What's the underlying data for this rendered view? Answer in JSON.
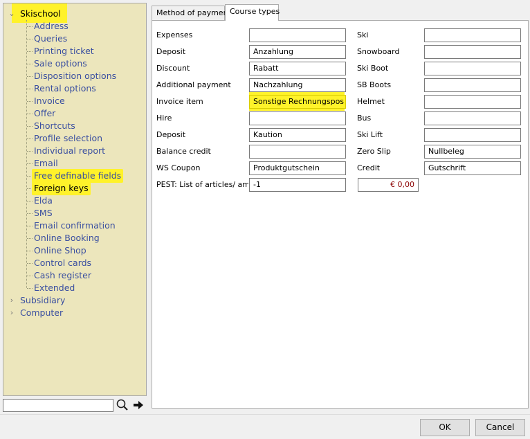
{
  "tree": {
    "root": "Skischool",
    "children": [
      "Address",
      "Queries",
      "Printing ticket",
      "Sale options",
      "Disposition options",
      "Rental options",
      "Invoice",
      "Offer",
      "Shortcuts",
      "Profile selection",
      "Individual report",
      "Email",
      "Free definable fields",
      "Foreign keys",
      "Elda",
      "SMS",
      "Email confirmation",
      "Online Booking",
      "Online Shop",
      "Control cards",
      "Cash register",
      "Extended"
    ],
    "selected": "Foreign keys",
    "others": [
      "Subsidiary",
      "Computer"
    ]
  },
  "search": {
    "value": ""
  },
  "tabs": [
    "Method of payment",
    "Course types"
  ],
  "active_tab": "Course types",
  "form": {
    "left": [
      {
        "label": "Expenses",
        "value": ""
      },
      {
        "label": "Deposit",
        "value": "Anzahlung"
      },
      {
        "label": "Discount",
        "value": "Rabatt"
      },
      {
        "label": "Additional payment",
        "value": "Nachzahlung"
      },
      {
        "label": "Invoice item",
        "value": "Sonstige Rechnungspos"
      },
      {
        "label": "Hire",
        "value": ""
      },
      {
        "label": "Deposit",
        "value": "Kaution"
      },
      {
        "label": "Balance credit",
        "value": ""
      },
      {
        "label": "WS Coupon",
        "value": "Produktgutschein"
      },
      {
        "label": "PEST: List of articles/ amour",
        "value": "-1"
      }
    ],
    "right": [
      {
        "label": "Ski",
        "value": ""
      },
      {
        "label": "Snowboard",
        "value": ""
      },
      {
        "label": "Ski Boot",
        "value": ""
      },
      {
        "label": "SB Boots",
        "value": ""
      },
      {
        "label": "Helmet",
        "value": ""
      },
      {
        "label": "Bus",
        "value": ""
      },
      {
        "label": "Ski Lift",
        "value": ""
      },
      {
        "label": "Zero Slip",
        "value": "Nullbeleg"
      },
      {
        "label": "Credit",
        "value": "Gutschrift"
      }
    ],
    "amount": "€ 0,00"
  },
  "buttons": {
    "ok": "OK",
    "cancel": "Cancel"
  },
  "colors": {
    "highlight": "#fff22a",
    "tree_bg": "#ece6bc",
    "link": "#3a4fa0",
    "amount": "#8b0000"
  },
  "icons": {
    "search": "magnifier-icon",
    "go": "arrow-right-icon",
    "expand": "chevron-right-icon",
    "collapse": "chevron-down-icon"
  }
}
